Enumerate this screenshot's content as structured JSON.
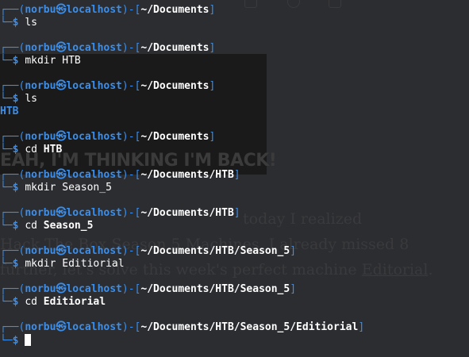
{
  "background": {
    "meme_caption": "EAH, I'M THINKING I'M BACK!",
    "text_line_1": "today I realized",
    "text_line_2": "Hack The Box Season 5 Machines. I already missed 8",
    "text_line_3_prefix": "further, let's solve this week's perfect machine ",
    "text_line_3_link": "Editorial",
    "text_line_3_suffix": "."
  },
  "prompt": {
    "user": "norbu",
    "at": "㉿",
    "host": "localhost"
  },
  "blocks": [
    {
      "path": "~/Documents",
      "command": "ls",
      "arg": ""
    },
    {
      "path": "~/Documents",
      "command": "mkdir",
      "arg": "HTB"
    },
    {
      "path": "~/Documents",
      "command": "ls",
      "arg": "",
      "output": "HTB"
    },
    {
      "path": "~/Documents",
      "command": "cd",
      "arg": "HTB"
    },
    {
      "path": "~/Documents/HTB",
      "command": "mkdir",
      "arg": "Season_5"
    },
    {
      "path": "~/Documents/HTB",
      "command": "cd",
      "arg": "Season_5"
    },
    {
      "path": "~/Documents/HTB/Season_5",
      "command": "mkdir",
      "arg": "Editiorial"
    },
    {
      "path": "~/Documents/HTB/Season_5",
      "command": "cd",
      "arg": "Editiorial"
    },
    {
      "path": "~/Documents/HTB/Season_5/Editiorial",
      "command": "",
      "arg": ""
    }
  ],
  "colors": {
    "terminal_bg": "#2b2d31",
    "prompt_blue": "#3b8eea",
    "text": "#ffffff"
  }
}
